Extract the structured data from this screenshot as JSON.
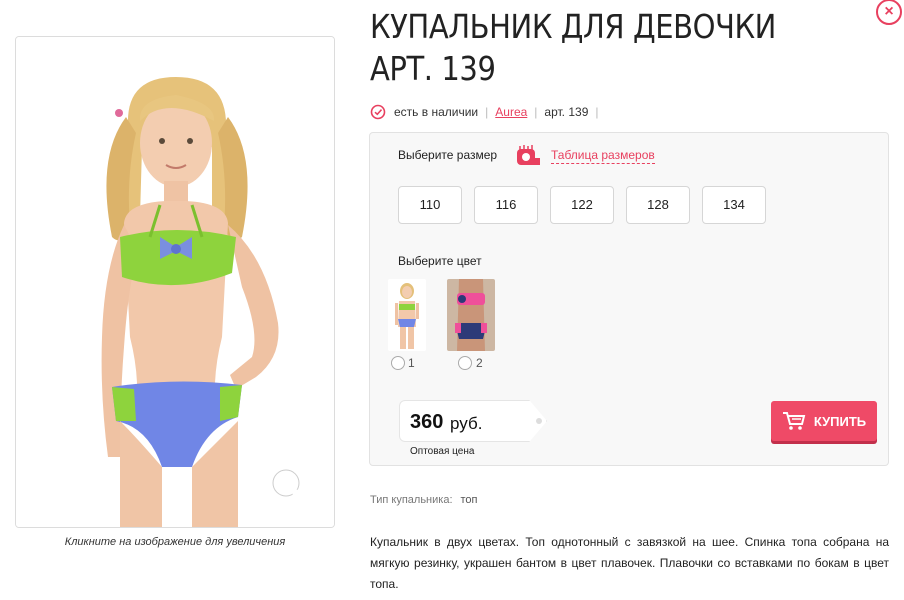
{
  "product": {
    "title": "КУПАЛЬНИК ДЛЯ ДЕВОЧКИ АРТ. 139",
    "availability": "есть в наличии",
    "brand": "Aurea",
    "article": "арт. 139"
  },
  "gallery": {
    "caption": "Кликните на изображение для увеличения"
  },
  "options": {
    "size_label": "Выберите размер",
    "size_table_link": "Таблица размеров",
    "sizes": [
      "110",
      "116",
      "122",
      "128",
      "134"
    ],
    "color_label": "Выберите цвет",
    "colors": [
      {
        "label": "1",
        "bikini": "green/blue print"
      },
      {
        "label": "2",
        "bikini": "pink/navy"
      }
    ]
  },
  "price": {
    "value": "360",
    "unit": "руб.",
    "note": "Оптовая цена"
  },
  "buy_button": {
    "label": "КУПИТЬ"
  },
  "attributes": [
    {
      "name": "Тип купальника:",
      "value": "топ"
    }
  ],
  "description": "Купальник в двух цветах. Топ однотонный с завязкой на шее. Спинка топа собрана на мягкую резинку, украшен бантом в цвет плавочек. Плавочки со вставками по бокам в цвет топа.",
  "icons": {
    "close": "close-icon",
    "availability": "check-circle-icon",
    "size_table": "measuring-tape-icon",
    "buy": "cart-icon",
    "zoom": "magnifier-icon"
  },
  "colors": {
    "accent": "#ef4a67",
    "link": "#e8405f",
    "panel_bg": "#f8f8f8",
    "border": "#e2e2e2"
  }
}
